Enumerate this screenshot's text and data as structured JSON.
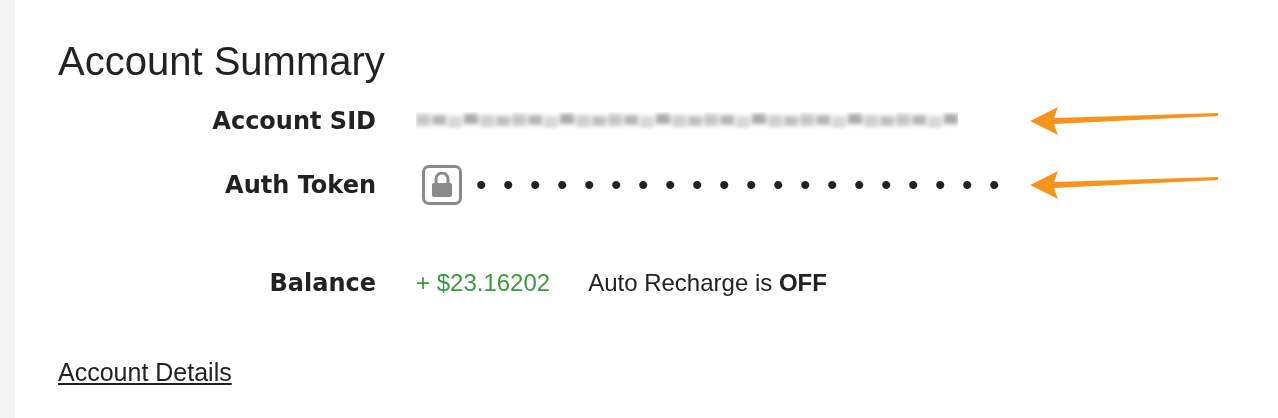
{
  "title": "Account Summary",
  "fields": [
    {
      "kind": "redacted",
      "label": "Account SID",
      "marked": true
    },
    {
      "kind": "secret",
      "label": "Auth Token",
      "value": "••••••••••••••••••••",
      "marked": true
    },
    {
      "kind": "balance",
      "label": "Balance",
      "value": "+ $23.16202",
      "note": "Auto Recharge is **OFF**",
      "marked": false
    }
  ],
  "link": "Account Details"
}
